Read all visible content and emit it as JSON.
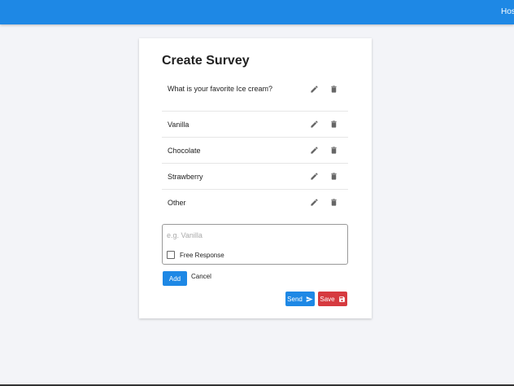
{
  "header": {
    "user_label": "Hos"
  },
  "card": {
    "title": "Create Survey",
    "question": "What is your favorite Ice cream?",
    "options": [
      "Vanilla",
      "Chocolate",
      "Strawberry",
      "Other"
    ],
    "input_placeholder": "e.g. Vanilla",
    "free_response_label": "Free Response",
    "add_label": "Add",
    "cancel_label": "Cancel",
    "send_label": "Send",
    "save_label": "Save"
  },
  "colors": {
    "primary": "#1e88e5",
    "danger": "#d63a3f"
  }
}
